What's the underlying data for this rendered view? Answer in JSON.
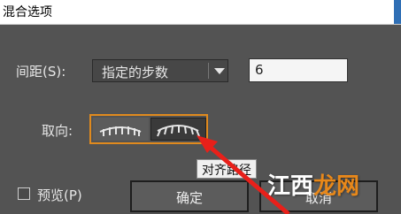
{
  "window": {
    "title": "混合选项"
  },
  "spacing": {
    "label": "间距(S):",
    "mode_value": "指定的步数",
    "steps_value": "6"
  },
  "orientation": {
    "label": "取向:",
    "tooltip": "对齐路径"
  },
  "preview": {
    "label": "预览(P)"
  },
  "buttons": {
    "ok_label": "确定",
    "cancel_label": "取消"
  },
  "watermark": {
    "part1": "江西",
    "part2": "龙网"
  },
  "colors": {
    "accent": "#e08a1e",
    "annotation_arrow": "#e8201a",
    "dialog_bg": "#535353"
  }
}
